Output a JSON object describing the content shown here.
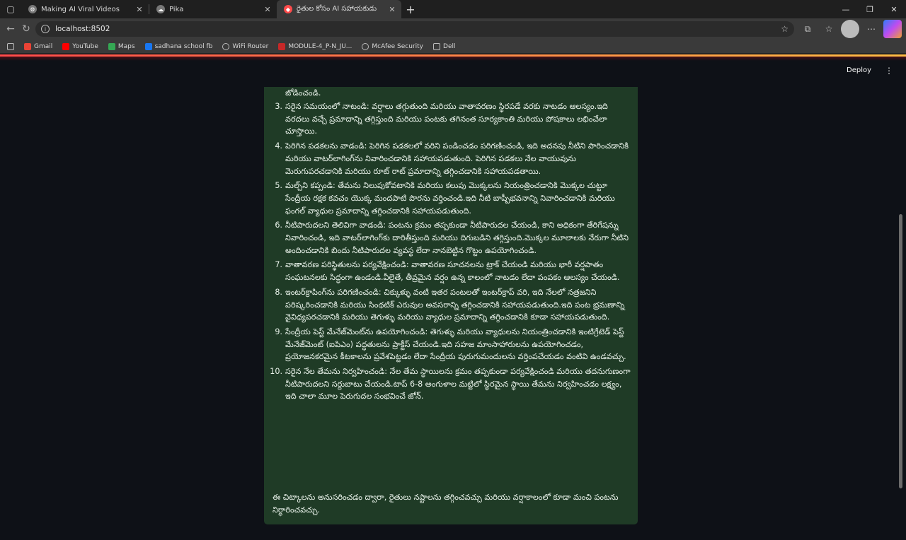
{
  "browser": {
    "tabs": [
      {
        "label": "Making AI Viral Videos",
        "active": false
      },
      {
        "label": "Pika",
        "active": false
      },
      {
        "label": "రైతుల కోసం AI సహాయకుడు",
        "active": true
      }
    ],
    "new_tab": "+",
    "url": "localhost:8502",
    "bookmarks": [
      "Gmail",
      "YouTube",
      "Maps",
      "sadhana school fb",
      "WiFi Router",
      "MODULE-4_P-N_JU...",
      "McAfee Security",
      "Dell"
    ]
  },
  "app": {
    "deploy_label": "Deploy",
    "menu_icon": "⋮",
    "colors": {
      "message_bg": "#1f3b26",
      "app_bg": "#0e1117",
      "accent": "#ff4b4b"
    }
  },
  "message": {
    "first_line": "జోడించండి.",
    "items": [
      {
        "num": "3.",
        "text": "సరైన సమయంలో నాటండి: వర్షాలు తగ్గుతుంది మరియు వాతావరణం స్థిరపడే వరకు నాటడం ఆలస్యం.ఇది వరదలు వచ్చే ప్రమాదాన్ని తగ్గిస్తుంది మరియు పంటకు తగినంత సూర్యకాంతి మరియు పోషకాలు లభించేలా చూస్తాయి."
      },
      {
        "num": "4.",
        "text": " పెరిగిన పడకలను వాడండి: పెరిగిన పడకలలో వరిని పండించడం పరిగణించండి, ఇది అదనపు నీటిని పారించడానికి మరియు వాటర్‌లాగింగ్‌ను నివారించడానికి సహాయపడుతుంది. పెరిగిన పడకలు నేల వాయువును మెరుగుపరచడానికి మరియు రూట్ రాట్ ప్రమాదాన్ని తగ్గించడానికి సహాయపడతాయి."
      },
      {
        "num": "5.",
        "text": "మల్చ్‌ని కప్పండి: తేమను నిలుపుకోవటానికి మరియు కలుపు మొక్కలను నియంత్రించడానికి మొక్కల చుట్టూ సేంద్రీయ రక్షక కవచం యొక్క మందపాటి పొరను వర్తించండి.ఇది నీటి బాష్పీభవనాన్ని నివారించడానికి మరియు ఫంగల్ వ్యాధుల ప్రమాదాన్ని తగ్గించడానికి సహాయపడుతుంది."
      },
      {
        "num": "6.",
        "text": "నీటిపారుదలని తెలివిగా వాడండి: పంటను క్రమం తప్పకుండా నీటిపారుదల చేయండి, కాని అధికంగా తేరిగేషన్ను నివారించండి, ఇది వాటర్‌లాగింగ్‌కు దారితీస్తుంది మరియు దిగుబడిని తగ్గిస్తుంది.మొక్కల మూలాలకు నేరుగా నీటిని అందించడానికి బిందు నీటిపారుదల వ్యవస్థ లేదా నానబెట్టిన గొట్టం ఉపయోగించండి."
      },
      {
        "num": "7.",
        "text": "వాతావరణ పరిస్థితులను పర్యవేక్షించండి: వాతావరణ సూచనలను ట్రాక్ చేయండి మరియు భారీ వర్షపాతం సంఘటనలకు సిద్ధంగా ఉండండి.వీలైతే, తీవ్రమైన వర్షం ఉన్న కాలంలో నాటడం లేదా పంపకం ఆలస్యం చేయండి."
      },
      {
        "num": "8.",
        "text": "ఇంటర్‌క్రాపింగ్‌ను పరిగణించండి: చిక్కుళ్ళు వంటి ఇతర పంటలతో ఇంటర్‌క్రాప్ వరి, ఇది నేలలో నత్రజనిని పరిష్కరించడానికి మరియు సింథటిక్ ఎరువుల అవసరాన్ని తగ్గించడానికి సహాయపడుతుంది.ఇది పంట భ్రమణాన్ని వైవిధ్యపరచడానికి మరియు తెగుళ్ళు మరియు వ్యాధుల ప్రమాదాన్ని తగ్గించడానికి కూడా సహాయపడుతుంది."
      },
      {
        "num": "9.",
        "text": " సేంద్రీయ పెస్ట్ మేనేజ్‌మెంట్‌ను ఉపయోగించండి: తెగుళ్ళు మరియు వ్యాధులను నియంత్రించడానికి ఇంటిగ్రేటెడ్ పెస్ట్ మేనేజ్‌మెంట్ (ఐపిఎం) పద్ధతులను ప్రాక్టీస్ చేయండి.ఇది సహజ మాంసాహారులను ఉపయోగించడం, ప్రయోజనకరమైన కీటకాలను ప్రవేశపెట్టడం లేదా సేంద్రీయ పురుగుమందులను వర్తింపచేయడం వంటివి ఉండవచ్చు."
      },
      {
        "num": "10.",
        "text": "సరైన నేల తేమను నిర్వహించండి: నేల తేమ స్థాయిలను క్రమం తప్పకుండా పర్యవేక్షించండి మరియు తదనుగుణంగా నీటిపారుదలని సర్దుబాటు చేయండి.టాప్ 6-8 అంగుళాల మట్టిలో స్థిరమైన స్థాయి తేమను నిర్వహించడం లక్ష్యం, ఇది చాలా మూల పెరుగుదల సంభవించే జోన్."
      }
    ],
    "closing": "ఈ చిట్కాలను అనుసరించడం ద్వారా, రైతులు నష్టాలను తగ్గించవచ్చు మరియు వర్షాకాలంలో కూడా మంచి పంటను నిర్ధారించవచ్చు."
  }
}
